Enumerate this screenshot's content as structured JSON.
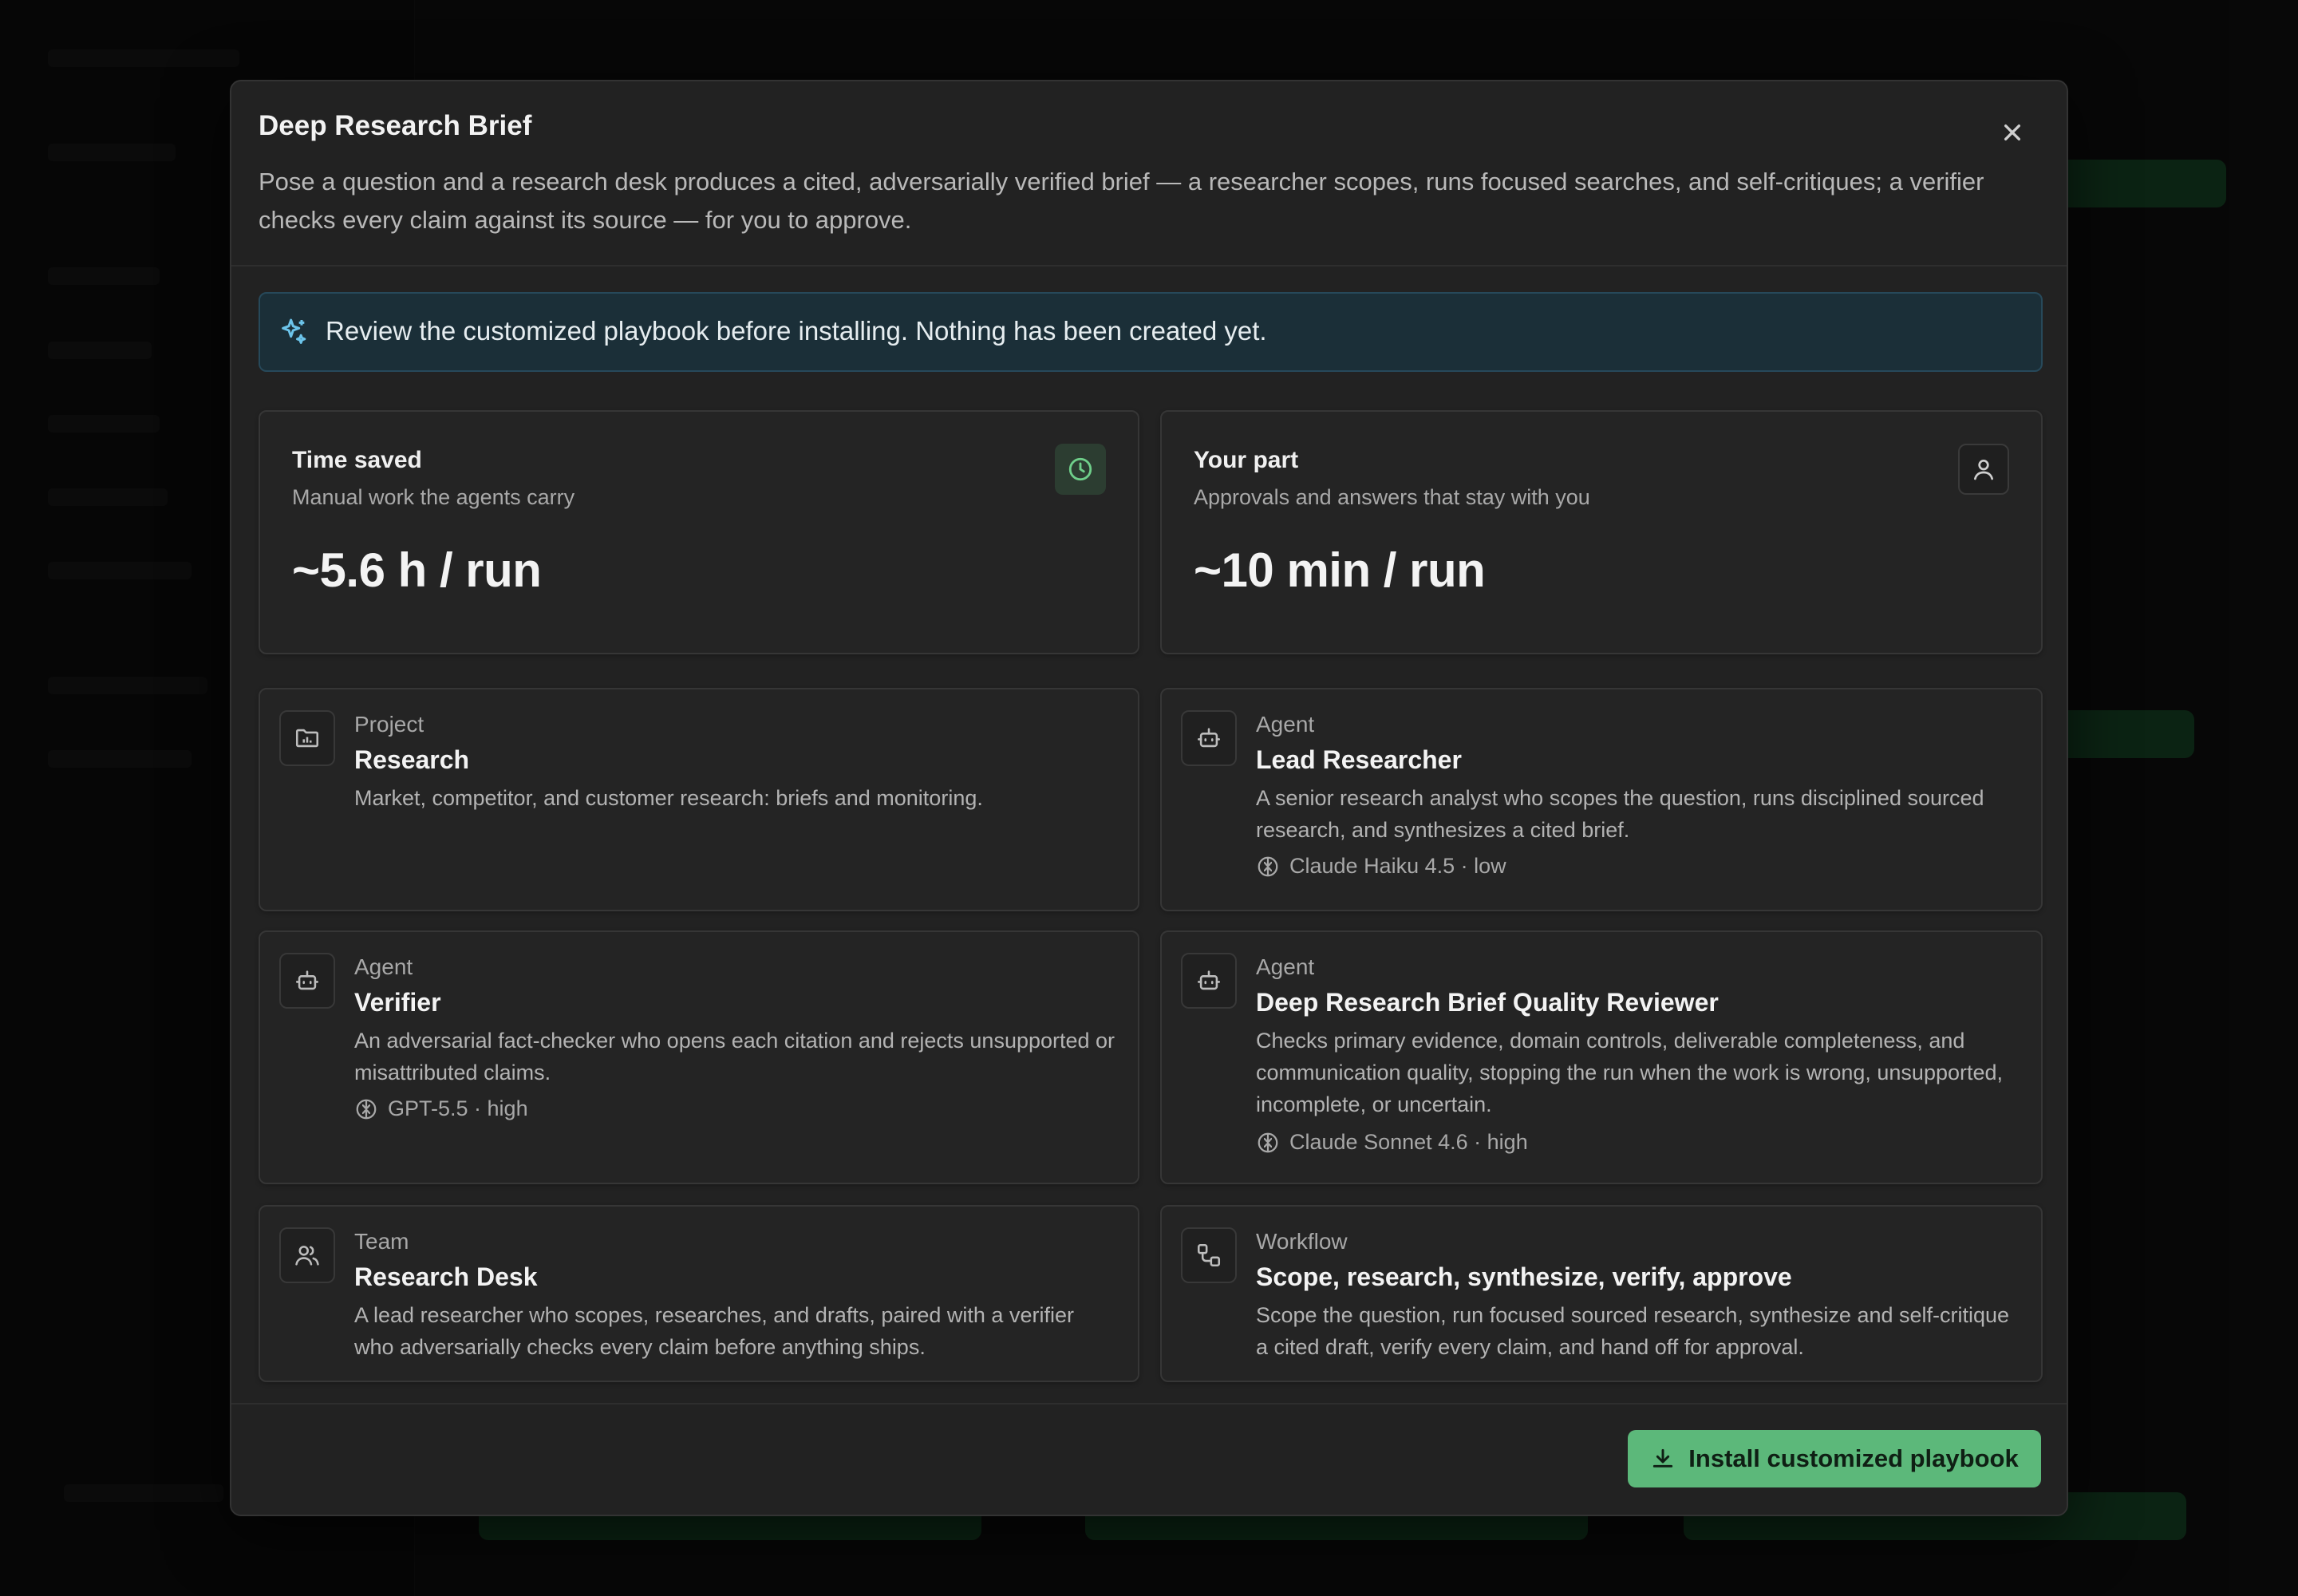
{
  "dialog": {
    "title": "Deep Research Brief",
    "description": "Pose a question and a research desk produces a cited, adversarially verified brief — a researcher scopes, runs focused searches, and self-critiques; a verifier checks every claim against its source — for you to approve.",
    "close_icon": "close-icon"
  },
  "banner": {
    "icon": "sparkles-icon",
    "text": "Review the customized playbook before installing. Nothing has been created yet."
  },
  "stats": [
    {
      "title": "Time saved",
      "subtitle": "Manual work the agents carry",
      "value": "~5.6 h / run",
      "icon": "clock-icon"
    },
    {
      "title": "Your part",
      "subtitle": "Approvals and answers that stay with you",
      "value": "~10 min / run",
      "icon": "user-icon"
    }
  ],
  "items": [
    {
      "type": "Project",
      "name": "Research",
      "description": "Market, competitor, and customer research: briefs and monitoring.",
      "icon": "folder-chart-icon"
    },
    {
      "type": "Agent",
      "name": "Lead Researcher",
      "description": "A senior research analyst who scopes the question, runs disciplined sourced research, and synthesizes a cited brief.",
      "model": "Claude Haiku 4.5 · low",
      "icon": "bot-icon"
    },
    {
      "type": "Agent",
      "name": "Verifier",
      "description": "An adversarial fact-checker who opens each citation and rejects unsupported or misattributed claims.",
      "model": "GPT-5.5 · high",
      "icon": "bot-icon"
    },
    {
      "type": "Agent",
      "name": "Deep Research Brief Quality Reviewer",
      "description": "Checks primary evidence, domain controls, deliverable completeness, and communication quality, stopping the run when the work is wrong, unsupported, incomplete, or uncertain.",
      "model": "Claude Sonnet 4.6 · high",
      "icon": "bot-icon"
    },
    {
      "type": "Team",
      "name": "Research Desk",
      "description": "A lead researcher who scopes, researches, and drafts, paired with a verifier who adversarially checks every claim before anything ships.",
      "icon": "users-icon"
    },
    {
      "type": "Workflow",
      "name": "Scope, research, synthesize, verify, approve",
      "description": "Scope the question, run focused sourced research, synthesize and self-critique a cited draft, verify every claim, and hand off for approval.",
      "icon": "workflow-icon"
    }
  ],
  "footer": {
    "install_label": "Install customized playbook",
    "install_icon": "download-icon"
  },
  "colors": {
    "accent": "#5cb87a",
    "banner_bg": "#1b2f38",
    "modal_bg": "#222222"
  }
}
